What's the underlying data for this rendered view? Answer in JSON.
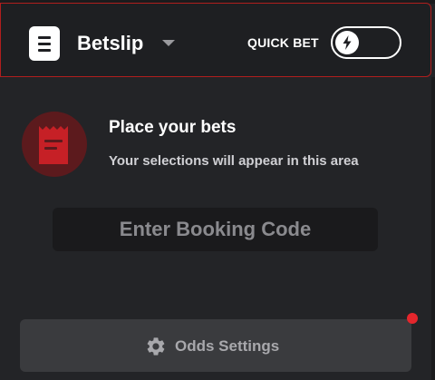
{
  "header": {
    "title": "Betslip",
    "quick_bet_label": "QUICK BET",
    "quick_bet_enabled": false,
    "icons": {
      "betslip": "betslip-list-icon",
      "dropdown": "chevron-down-icon",
      "toggle": "lightning-bolt-icon"
    }
  },
  "empty_state": {
    "title": "Place your bets",
    "subtitle": "Your selections will appear in this area",
    "icon": "receipt-icon"
  },
  "booking_code": {
    "placeholder": "Enter Booking Code",
    "value": ""
  },
  "odds_settings": {
    "label": "Odds Settings",
    "icon": "gear-icon",
    "has_notification": true
  },
  "colors": {
    "background": "#232427",
    "header_background": "#1e1f22",
    "header_border": "#b01e1e",
    "accent_red": "#e4262c",
    "receipt_red": "#c62026",
    "receipt_circle": "#5c1a1d",
    "input_background": "#1a1a1c",
    "button_background": "#3a3b3e",
    "muted_text": "#a8a8ac"
  }
}
